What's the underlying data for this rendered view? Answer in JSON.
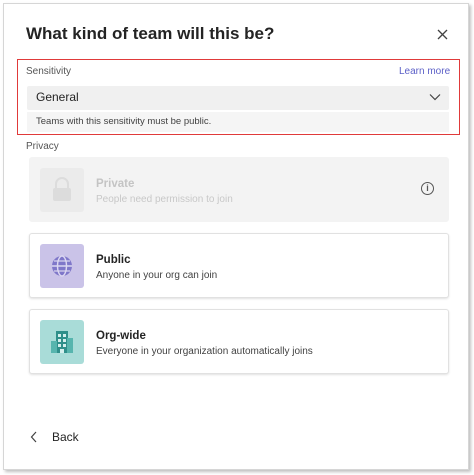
{
  "dialog": {
    "title": "What kind of team will this be?"
  },
  "sensitivity": {
    "label": "Sensitivity",
    "learn_more": "Learn more",
    "selected": "General",
    "hint": "Teams with this sensitivity must be public."
  },
  "privacy": {
    "label": "Privacy",
    "options": [
      {
        "title": "Private",
        "description": "People need permission to join",
        "icon": "lock-icon",
        "disabled": true
      },
      {
        "title": "Public",
        "description": "Anyone in your org can join",
        "icon": "globe-icon",
        "color": "#cac3e8"
      },
      {
        "title": "Org-wide",
        "description": "Everyone in your organization automatically joins",
        "icon": "building-icon",
        "color": "#a9dcd8"
      }
    ]
  },
  "footer": {
    "back_label": "Back"
  }
}
